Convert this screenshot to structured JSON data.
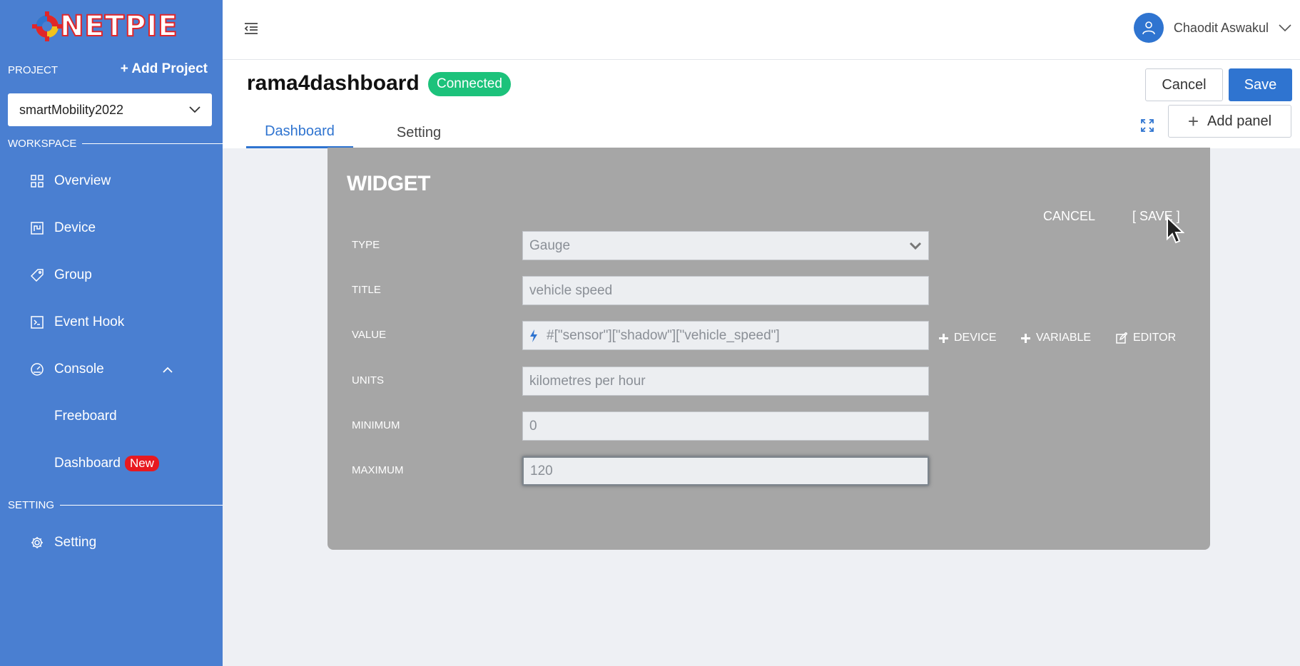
{
  "sidebar": {
    "logo_text": "NETPIE",
    "project_label": "PROJECT",
    "add_project_label": "+ Add Project",
    "selected_project": "smartMobility2022",
    "workspace_label": "WORKSPACE",
    "setting_section_label": "SETTING",
    "items": [
      {
        "label": "Overview",
        "icon": "grid-icon"
      },
      {
        "label": "Device",
        "icon": "device-icon"
      },
      {
        "label": "Group",
        "icon": "tag-icon"
      },
      {
        "label": "Event Hook",
        "icon": "terminal-icon"
      },
      {
        "label": "Console",
        "icon": "gauge-icon"
      }
    ],
    "console_sub": [
      {
        "label": "Freeboard"
      },
      {
        "label": "Dashboard",
        "badge": "New"
      }
    ],
    "setting_item": {
      "label": "Setting",
      "icon": "gear-icon"
    }
  },
  "topbar": {
    "user_name": "Chaodit Aswakul"
  },
  "header": {
    "dashboard_name": "rama4dashboard",
    "status": "Connected",
    "cancel_label": "Cancel",
    "save_label": "Save",
    "tabs": [
      {
        "label": "Dashboard",
        "active": true
      },
      {
        "label": "Setting",
        "active": false
      }
    ],
    "add_panel_label": "Add panel"
  },
  "widget": {
    "title": "WIDGET",
    "cancel_label": "CANCEL",
    "save_label": "[ SAVE ]",
    "fields": {
      "type": {
        "label": "TYPE",
        "value": "Gauge"
      },
      "title": {
        "label": "TITLE",
        "value": "vehicle speed"
      },
      "value": {
        "label": "VALUE",
        "value": "#[\"sensor\"][\"shadow\"][\"vehicle_speed\"]"
      },
      "units": {
        "label": "UNITS",
        "value": "kilometres per hour"
      },
      "minimum": {
        "label": "MINIMUM",
        "value": "0"
      },
      "maximum": {
        "label": "MAXIMUM",
        "value": "120"
      }
    },
    "value_actions": {
      "device": "DEVICE",
      "variable": "VARIABLE",
      "editor": "EDITOR"
    }
  },
  "colors": {
    "sidebar": "#4a7fd1",
    "accent": "#2f74d0",
    "connected": "#1cc27b",
    "badge_new": "#e8191f",
    "modal": "#a6a6a6"
  }
}
